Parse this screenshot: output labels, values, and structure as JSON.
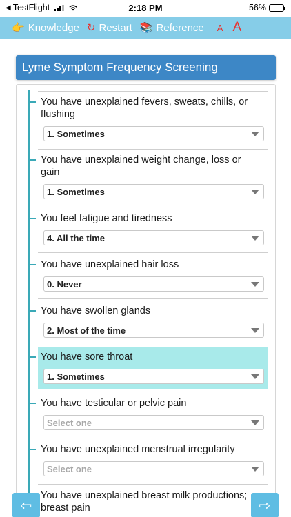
{
  "status_bar": {
    "back_app": "TestFlight",
    "time": "2:18 PM",
    "battery_percent": "56%",
    "battery_level": 0.56
  },
  "toolbar": {
    "knowledge": {
      "icon": "pointing-hand-icon",
      "glyph": "👉",
      "label": "Knowledge"
    },
    "restart": {
      "icon": "restart-icon",
      "glyph": "↻",
      "label": "Restart"
    },
    "reference": {
      "icon": "books-icon",
      "glyph": "📚",
      "label": "Reference"
    },
    "font_small": "A",
    "font_large": "A",
    "font_color": "#e8322e"
  },
  "screening": {
    "title": "Lyme Symptom Frequency Screening",
    "questions": [
      {
        "text": "You have unexplained fevers, sweats, chills, or flushing",
        "answer": "1. Sometimes"
      },
      {
        "text": "You have unexplained weight change, loss or gain",
        "answer": "1. Sometimes"
      },
      {
        "text": "You feel fatigue and tiredness",
        "answer": "4. All the time"
      },
      {
        "text": "You have unexplained hair loss",
        "answer": "0. Never"
      },
      {
        "text": "You have swollen glands",
        "answer": "2. Most of the time"
      },
      {
        "text": "You have sore throat",
        "answer": "1. Sometimes"
      },
      {
        "text": "You have testicular or pelvic pain",
        "answer": "Select one"
      },
      {
        "text": "You have unexplained menstrual irregularity",
        "answer": "Select one"
      },
      {
        "text": "You have unexplained breast milk productions; breast pain",
        "answer": ""
      }
    ]
  },
  "nav": {
    "prev_glyph": "⇦",
    "next_glyph": "⇨"
  },
  "colors": {
    "toolbar_bg": "#86cde8",
    "header_bg": "#3d87c6",
    "highlight": "#a8eaea",
    "tree_line": "#3aa9b7",
    "nav_button": "#5fbde3"
  }
}
